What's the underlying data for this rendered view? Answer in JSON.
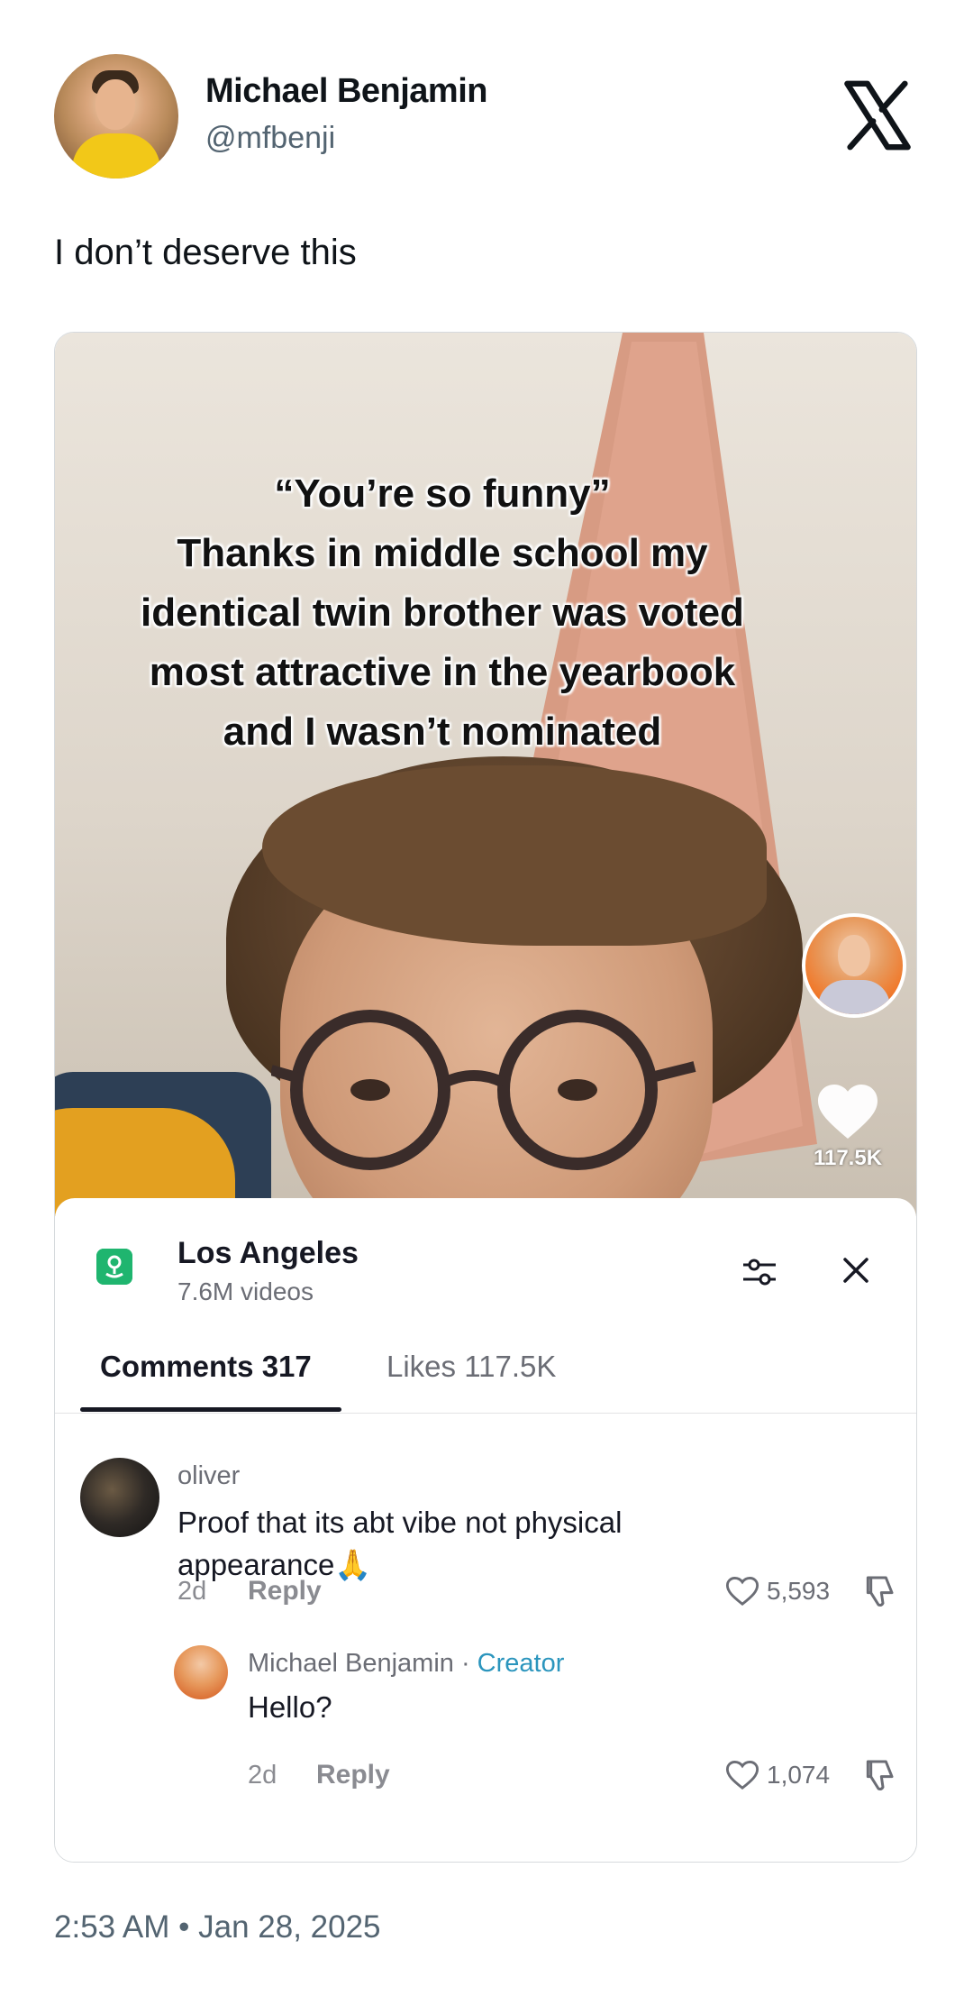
{
  "author": {
    "name": "Michael Benjamin",
    "handle": "@mfbenji"
  },
  "tweet_text": "I don’t deserve this",
  "video": {
    "overlay_text": "“You’re so funny”\nThanks in middle school my\nidentical twin brother was voted\nmost attractive in the yearbook\nand I wasn’t nominated",
    "like_count": "117.5K"
  },
  "panel": {
    "location_title": "Los Angeles",
    "location_videos": "7.6M videos",
    "tab_comments": "Comments 317",
    "tab_likes": "Likes 117.5K"
  },
  "comment": {
    "user": "oliver",
    "text": "Proof that its abt vibe not physical appearance🙏",
    "age": "2d",
    "reply_label": "Reply",
    "likes": "5,593"
  },
  "reply": {
    "user": "Michael Benjamin",
    "separator": " · ",
    "badge": "Creator",
    "text": "Hello?",
    "age": "2d",
    "reply_label": "Reply",
    "likes": "1,074"
  },
  "timestamp": "2:53 AM • Jan 28, 2025",
  "colors": {
    "accent_green": "#1fb56f",
    "creator_blue": "#2b95bd",
    "muted": "#536471"
  }
}
